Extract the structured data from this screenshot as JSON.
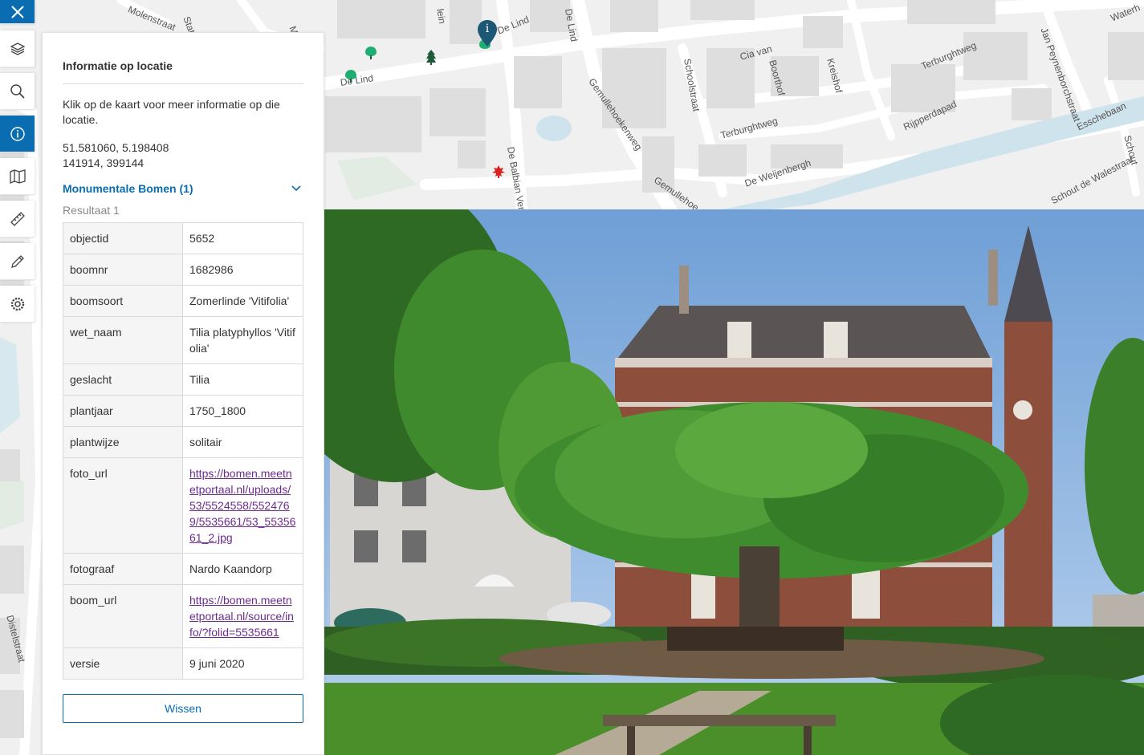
{
  "map": {
    "streets": [
      "Molenstraat",
      "Statio",
      "De Lind",
      "De Lind",
      "De Lind",
      "Gemullehoekenweg",
      "Schoolstraat",
      "Cia van",
      "Boorthof",
      "Kreishof",
      "Terburghtweg",
      "Terburghtweg",
      "Jan Peynenborchstraat",
      "Waterh",
      "Rijpperdapad",
      "Esschebaan",
      "Schout",
      "De Weijenbergh",
      "Gemullehoe",
      "De Balbian Verst",
      "Schout de Walestraat",
      "Distelstraat",
      "Me",
      "lein"
    ],
    "marker_label": "i",
    "colors": {
      "tree_green": "#1fae72",
      "tree_dark": "#1e5a3a",
      "tree_red": "#d9221e",
      "marker": "#1c5873"
    }
  },
  "toolbar": {
    "items": [
      {
        "name": "close",
        "icon": "close-icon"
      },
      {
        "name": "layers",
        "icon": "layers-icon"
      },
      {
        "name": "search",
        "icon": "search-icon"
      },
      {
        "name": "info",
        "icon": "info-icon"
      },
      {
        "name": "map",
        "icon": "map-icon"
      },
      {
        "name": "measure",
        "icon": "ruler-icon"
      },
      {
        "name": "draw",
        "icon": "pencil-icon"
      },
      {
        "name": "settings",
        "icon": "gear-icon"
      }
    ]
  },
  "panel": {
    "title": "Informatie op locatie",
    "intro": "Klik op de kaart voor meer informatie op die locatie.",
    "coords_wgs": "51.581060, 5.198408",
    "coords_rd": "141914, 399144",
    "section_title": "Monumentale Bomen (1)",
    "result_label": "Resultaat 1",
    "rows": [
      {
        "key": "objectid",
        "value": "5652"
      },
      {
        "key": "boomnr",
        "value": "1682986"
      },
      {
        "key": "boomsoort",
        "value": "Zomerlinde 'Vitifolia'"
      },
      {
        "key": "wet_naam",
        "value": "Tilia platyphyllos 'Vitifolia'"
      },
      {
        "key": "geslacht",
        "value": "Tilia"
      },
      {
        "key": "plantjaar",
        "value": "1750_1800"
      },
      {
        "key": "plantwijze",
        "value": "solitair"
      },
      {
        "key": "foto_url",
        "value": "https://bomen.meetnetportaal.nl/uploads/53/5524558/5524769/5535661/53_5535661_2.jpg",
        "link": true
      },
      {
        "key": "fotograaf",
        "value": "Nardo Kaandorp"
      },
      {
        "key": "boom_url",
        "value": "https://bomen.meetnetportaal.nl/source/info/?folid=5535661",
        "link": true
      },
      {
        "key": "versie",
        "value": "9 juni 2020"
      }
    ],
    "clear_button": "Wissen"
  },
  "photo": {
    "alt": ""
  }
}
